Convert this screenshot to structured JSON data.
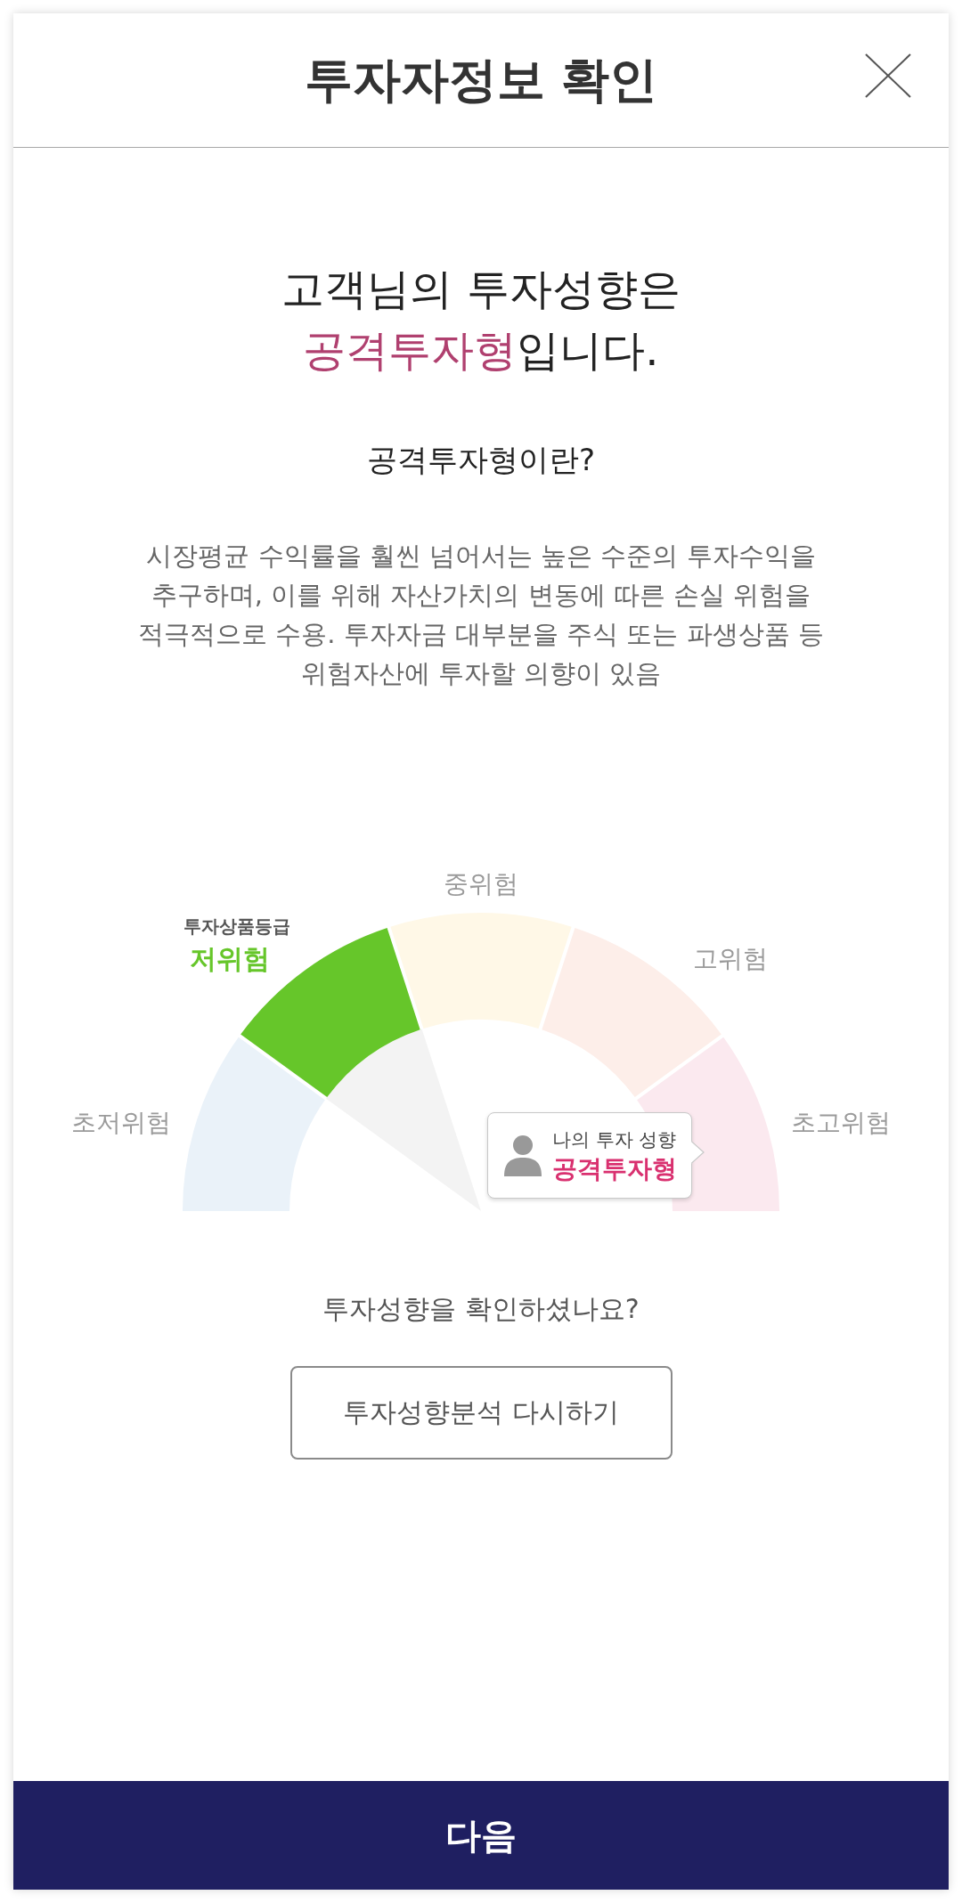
{
  "header": {
    "title": "투자자정보 확인"
  },
  "result": {
    "intro": "고객님의 투자성향은",
    "profile": "공격투자형",
    "suffix": "입니다."
  },
  "definition": {
    "title": "공격투자형이란?",
    "description": "시장평균 수익률을 훨씬 넘어서는 높은 수준의 투자수익을 추구하며, 이를 위해 자산가치의 변동에 따른 손실 위험을 적극적으로 수용. 투자자금 대부분을 주식 또는 파생상품 등 위험자산에 투자할 의향이 있음"
  },
  "gauge": {
    "caption": "투자상품등급",
    "segments": [
      {
        "label": "초저위험",
        "color": "#eaf2f9",
        "selected": false
      },
      {
        "label": "저위험",
        "color": "#66c62a",
        "selected": true
      },
      {
        "label": "중위험",
        "color": "#fff8e7",
        "selected": false
      },
      {
        "label": "고위험",
        "color": "#fdeee9",
        "selected": false
      },
      {
        "label": "초고위험",
        "color": "#fbe9ef",
        "selected": false
      }
    ],
    "my_profile": {
      "caption": "나의 투자 성향",
      "value": "공격투자형"
    }
  },
  "confirm": {
    "question": "투자성향을 확인하셨나요?",
    "retry_button": "투자성향분석 다시하기"
  },
  "footer": {
    "next_button": "다음"
  }
}
